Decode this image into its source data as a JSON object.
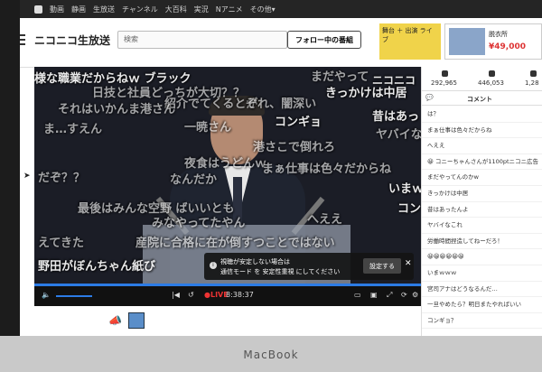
{
  "topnav": {
    "items": [
      "動画",
      "静画",
      "生放送",
      "チャンネル",
      "大百科",
      "実況",
      "Nアニメ",
      "その他▾"
    ]
  },
  "header": {
    "brand": "ニコニコ生放送",
    "search_placeholder": "検索",
    "follow_label": "フォロー中の番組",
    "ad1_text": "舞台 ＋ 出演 ライブ",
    "ad2_title": "脱衣所",
    "ad2_price": "¥49,000"
  },
  "player": {
    "comments": [
      "様な職業だからねｗ ブラック",
      "まだやって",
      "ニコニコ",
      "日技と社員どっちが大切？？",
      "紹介でてくるとが",
      "きっかけは中居",
      "それはいかんま港さん",
      "ぞれ、闇深い",
      "昔はあっ",
      "ま…すえん",
      "一暁さん",
      "コンギョ",
      "ヤバイな",
      "港さこで倒れろ",
      "夜食はうどんｗ",
      "まぁ仕事は色々だからね",
      "なんだか",
      "いまｗｗ",
      "だぞ？？",
      "コン",
      "最後はみんな空野 ばいいとも",
      "みなやってたやん",
      "へええ",
      "えてきた",
      "産院に合格に在が倒すつことではない",
      "野田がぼんちゃん紙び"
    ],
    "notice_line1": "視聴が安定しない場合は",
    "notice_line2": "通信モード を 安定性重視 にしてください",
    "notice_button": "設定する",
    "notice_close": "✕",
    "live_label": "●LIVE",
    "elapsed": "8:38:37",
    "progress": 1.0
  },
  "side": {
    "stats": [
      "292,965",
      "446,053",
      "1,28"
    ],
    "tab_comment": "コメント",
    "comments": [
      "は？",
      "まぁ仕事は色々だからね",
      "へええ",
      "😀 コニーちゃんさんが1100ptニコニ広告",
      "まだやってんのかw",
      "きっかけは中居",
      "昔はあったんよ",
      "ヤバイなこれ",
      "労働時間捏造してねーだろ！",
      "😀😀😀😀😀😀",
      "いまｗｗｗ",
      "宮司アナはどうなるんだ…",
      "一旦やめたら？明日またやればいい",
      "コンギョ？"
    ]
  },
  "laptop_label": "MacBook"
}
